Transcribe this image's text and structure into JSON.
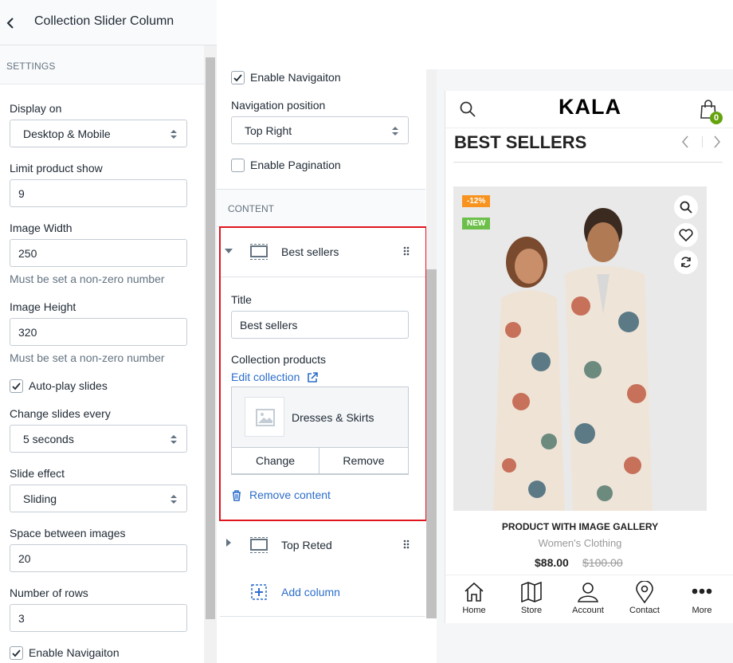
{
  "left_panel": {
    "title": "Collection Slider Column",
    "section": "SETTINGS",
    "display_on": {
      "label": "Display on",
      "value": "Desktop & Mobile"
    },
    "limit_product": {
      "label": "Limit product show",
      "value": "9"
    },
    "image_width": {
      "label": "Image Width",
      "value": "250",
      "hint": "Must be set a non-zero number"
    },
    "image_height": {
      "label": "Image Height",
      "value": "320",
      "hint": "Must be set a non-zero number"
    },
    "autoplay": {
      "label": "Auto-play slides",
      "checked": true
    },
    "change_slides": {
      "label": "Change slides every",
      "value": "5 seconds"
    },
    "slide_effect": {
      "label": "Slide effect",
      "value": "Sliding"
    },
    "space_between": {
      "label": "Space between images",
      "value": "20"
    },
    "rows": {
      "label": "Number of rows",
      "value": "3"
    },
    "enable_nav": {
      "label": "Enable Navigaiton",
      "checked": true
    }
  },
  "middle_panel": {
    "enable_nav": {
      "label": "Enable Navigaiton",
      "checked": true
    },
    "nav_position": {
      "label": "Navigation position",
      "value": "Top Right"
    },
    "enable_pagination": {
      "label": "Enable Pagination",
      "checked": false
    },
    "content_header": "CONTENT",
    "blocks": [
      {
        "name": "Best sellers",
        "expanded": true
      },
      {
        "name": "Top Reted",
        "expanded": false
      }
    ],
    "expanded_block": {
      "title_label": "Title",
      "title_value": "Best sellers",
      "collection_label": "Collection products",
      "edit_collection": "Edit collection",
      "collection_name": "Dresses & Skirts",
      "change_button": "Change",
      "remove_button": "Remove",
      "remove_content": "Remove content"
    },
    "add_column": "Add column"
  },
  "preview": {
    "logo": "KALA",
    "cart_count": "0",
    "section_title": "BEST SELLERS",
    "badge_sale": "-12%",
    "badge_new": "NEW",
    "product_title": "PRODUCT WITH IMAGE GALLERY",
    "product_category": "Women's Clothing",
    "price": "$88.00",
    "compare_price": "$100.00",
    "bottom_nav": [
      {
        "label": "Home",
        "icon": "home-icon"
      },
      {
        "label": "Store",
        "icon": "map-icon"
      },
      {
        "label": "Account",
        "icon": "user-icon"
      },
      {
        "label": "Contact",
        "icon": "location-pin-icon"
      },
      {
        "label": "More",
        "icon": "more-dots-icon"
      }
    ]
  },
  "colors": {
    "accent_blue": "#2c6ecb",
    "highlight_red": "#e0151e",
    "badge_orange": "#f7931e",
    "badge_green": "#6cc04a",
    "cart_green": "#65a30d"
  }
}
